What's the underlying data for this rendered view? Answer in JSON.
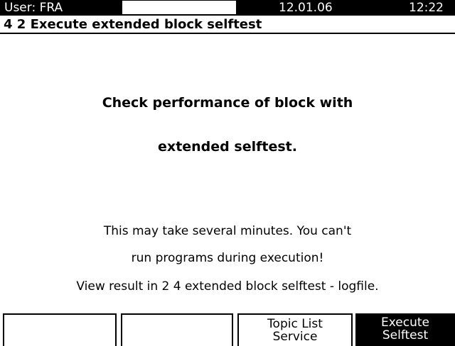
{
  "status_bar": {
    "user": "User: FRA",
    "date": "12.01.06",
    "time": "12:22"
  },
  "title": "4 2  Execute extended block selftest",
  "message": {
    "heading_line1": "Check performance of block with",
    "heading_line2": "extended selftest.",
    "info_line1": "This may take several minutes. You can't",
    "info_line2": "run programs during execution!",
    "info_line3": "View result in 2 4 extended block selftest - logfile."
  },
  "softkeys": {
    "key1": {
      "line1": "",
      "line2": ""
    },
    "key2": {
      "line1": "",
      "line2": ""
    },
    "key3": {
      "line1": "Topic List",
      "line2": "Service"
    },
    "key4": {
      "line1": "Execute",
      "line2": "Selftest"
    }
  },
  "colors": {
    "background": "#ffffff",
    "foreground": "#000000",
    "active_key": "#000000"
  }
}
